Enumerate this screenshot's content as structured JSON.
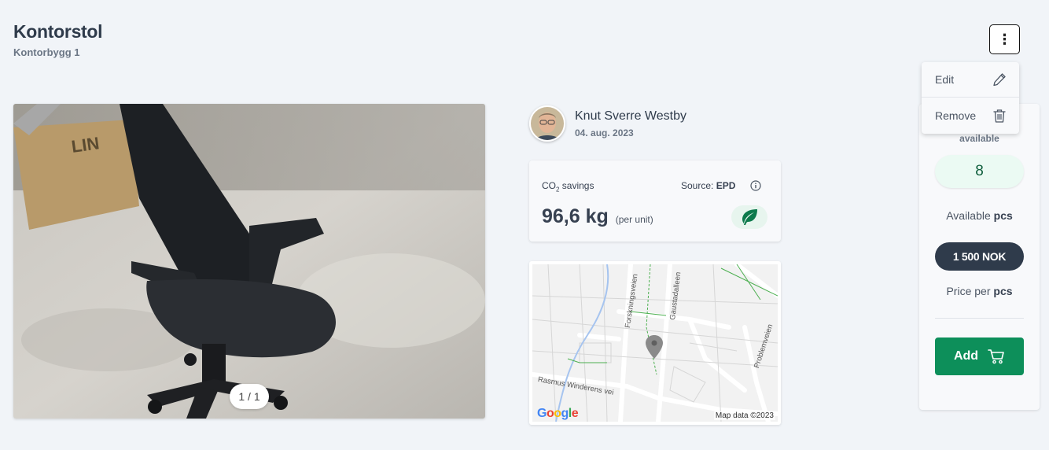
{
  "header": {
    "title": "Kontorstol",
    "subtitle": "Kontorbygg 1"
  },
  "gallery": {
    "counter": "1 / 1"
  },
  "seller": {
    "name": "Knut Sverre Westby",
    "date": "04. aug. 2023"
  },
  "co2": {
    "label": "CO",
    "label_sub": "2",
    "label_suffix": " savings",
    "source_label": "Source: ",
    "source_value": "EPD",
    "value": "96,6 kg",
    "unit": "(per unit)"
  },
  "map": {
    "credit": "Map data ©2023",
    "streets": [
      "Forskningsveien",
      "Gaustadalleen",
      "Problemveien",
      "Rasmus Winderens vei"
    ]
  },
  "panel": {
    "available_top": "available",
    "quantity": "8",
    "available_prefix": "Available ",
    "available_unit": "pcs",
    "price": "1 500 NOK",
    "price_prefix": "Price per ",
    "price_unit": "pcs",
    "add_label": "Add"
  },
  "menu": {
    "edit_label": "Edit",
    "remove_label": "Remove"
  },
  "colors": {
    "accent": "#0d8f5a",
    "price_bg": "#2f3b4b",
    "qty_bg": "#ebfaf3",
    "background": "#f1f4f8"
  },
  "icons": [
    "kebab-icon",
    "pencil-icon",
    "trash-icon",
    "info-icon",
    "leaf-icon",
    "cart-icon",
    "map-pin-icon"
  ]
}
